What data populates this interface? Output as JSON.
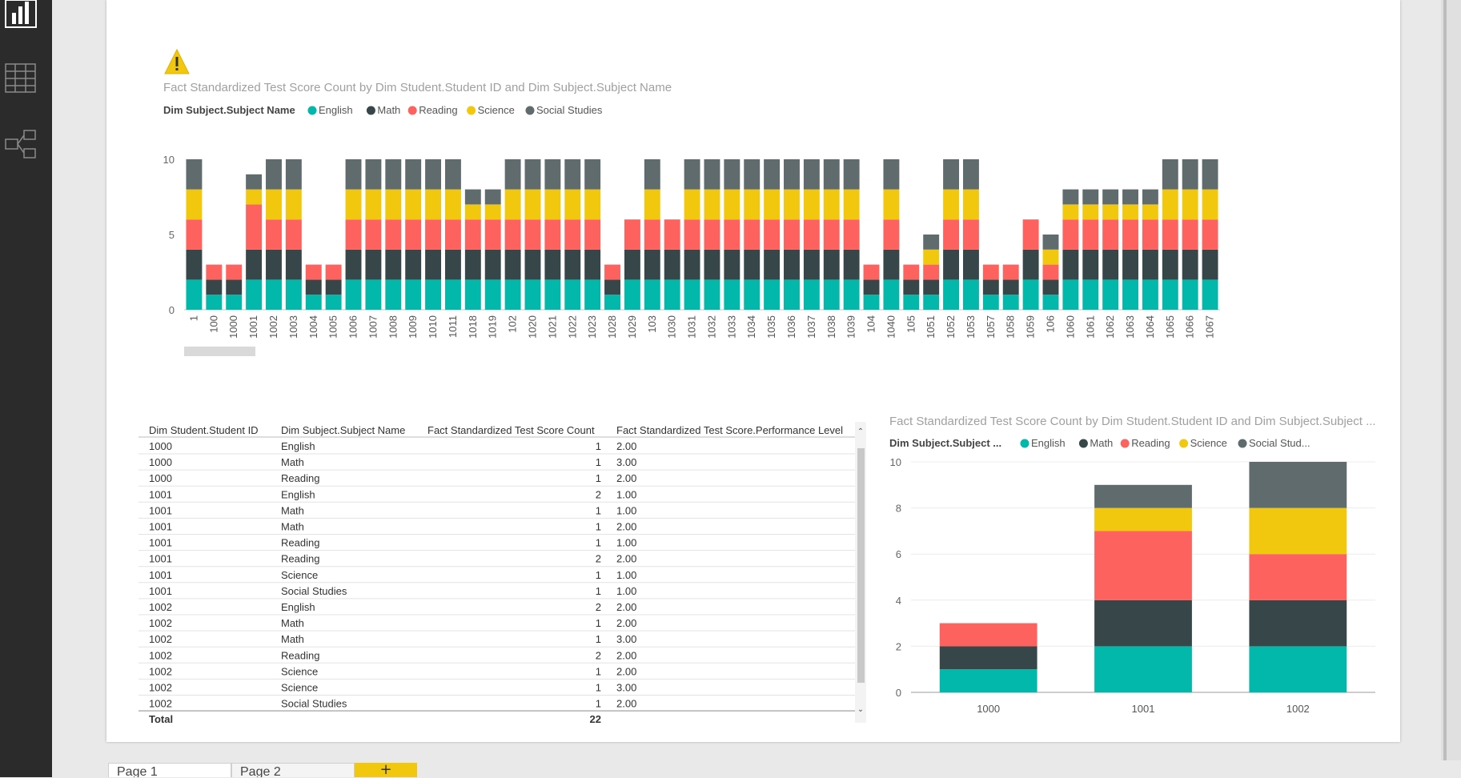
{
  "warning_icon": "warning-triangle-icon",
  "left_nav": [
    {
      "icon": "report-view-icon",
      "active": true
    },
    {
      "icon": "data-view-icon",
      "active": false
    },
    {
      "icon": "relationship-view-icon",
      "active": false
    }
  ],
  "colors": {
    "English": "#01b8aa",
    "Math": "#374649",
    "Reading": "#fd625e",
    "Science": "#f2c80f",
    "Social Studies": "#5f6b6d"
  },
  "chart_data": [
    {
      "type": "bar",
      "stacked": true,
      "title": "Fact Standardized Test Score Count by Dim Student.Student ID and Dim Subject.Subject Name",
      "legend_title": "Dim Subject.Subject Name",
      "legend": [
        "English",
        "Math",
        "Reading",
        "Science",
        "Social Studies"
      ],
      "legend_position": "top-left",
      "ylim": [
        0,
        10
      ],
      "yticks": [
        0,
        5,
        10
      ],
      "grid": false,
      "categories": [
        "1",
        "100",
        "1000",
        "1001",
        "1002",
        "1003",
        "1004",
        "1005",
        "1006",
        "1007",
        "1008",
        "1009",
        "1010",
        "1011",
        "1018",
        "1019",
        "102",
        "1020",
        "1021",
        "1022",
        "1023",
        "1028",
        "1029",
        "103",
        "1030",
        "1031",
        "1032",
        "1033",
        "1034",
        "1035",
        "1036",
        "1037",
        "1038",
        "1039",
        "104",
        "1040",
        "105",
        "1051",
        "1052",
        "1053",
        "1057",
        "1058",
        "1059",
        "106",
        "1060",
        "1061",
        "1062",
        "1063",
        "1064",
        "1065",
        "1066",
        "1067"
      ],
      "series": [
        {
          "name": "English",
          "values": [
            2,
            1,
            1,
            2,
            2,
            2,
            1,
            1,
            2,
            2,
            2,
            2,
            2,
            2,
            2,
            2,
            2,
            2,
            2,
            2,
            2,
            1,
            2,
            2,
            2,
            2,
            2,
            2,
            2,
            2,
            2,
            2,
            2,
            2,
            1,
            2,
            1,
            1,
            2,
            2,
            1,
            1,
            2,
            1,
            2,
            2,
            2,
            2,
            2,
            2,
            2,
            2
          ]
        },
        {
          "name": "Math",
          "values": [
            2,
            1,
            1,
            2,
            2,
            2,
            1,
            1,
            2,
            2,
            2,
            2,
            2,
            2,
            2,
            2,
            2,
            2,
            2,
            2,
            2,
            1,
            2,
            2,
            2,
            2,
            2,
            2,
            2,
            2,
            2,
            2,
            2,
            2,
            1,
            2,
            1,
            1,
            2,
            2,
            1,
            1,
            2,
            1,
            2,
            2,
            2,
            2,
            2,
            2,
            2,
            2
          ]
        },
        {
          "name": "Reading",
          "values": [
            2,
            1,
            1,
            3,
            2,
            2,
            1,
            1,
            2,
            2,
            2,
            2,
            2,
            2,
            2,
            2,
            2,
            2,
            2,
            2,
            2,
            1,
            2,
            2,
            2,
            2,
            2,
            2,
            2,
            2,
            2,
            2,
            2,
            2,
            1,
            2,
            1,
            1,
            2,
            2,
            1,
            1,
            2,
            1,
            2,
            2,
            2,
            2,
            2,
            2,
            2,
            2
          ]
        },
        {
          "name": "Science",
          "values": [
            2,
            0,
            0,
            1,
            2,
            2,
            0,
            0,
            2,
            2,
            2,
            2,
            2,
            2,
            1,
            1,
            2,
            2,
            2,
            2,
            2,
            0,
            0,
            2,
            0,
            2,
            2,
            2,
            2,
            2,
            2,
            2,
            2,
            2,
            0,
            2,
            0,
            1,
            2,
            2,
            0,
            0,
            0,
            1,
            1,
            1,
            1,
            1,
            1,
            2,
            2,
            2
          ]
        },
        {
          "name": "Social Studies",
          "values": [
            2,
            0,
            0,
            1,
            2,
            2,
            0,
            0,
            2,
            2,
            2,
            2,
            2,
            2,
            1,
            1,
            2,
            2,
            2,
            2,
            2,
            0,
            0,
            2,
            0,
            2,
            2,
            2,
            2,
            2,
            2,
            2,
            2,
            2,
            0,
            2,
            0,
            1,
            2,
            2,
            0,
            0,
            0,
            1,
            1,
            1,
            1,
            1,
            1,
            2,
            2,
            2
          ]
        }
      ]
    },
    {
      "type": "bar",
      "stacked": true,
      "title": "Fact Standardized Test Score Count by Dim Student.Student ID and Dim Subject.Subject ...",
      "legend_title": "Dim Subject.Subject ...",
      "legend": [
        "English",
        "Math",
        "Reading",
        "Science",
        "Social Stud..."
      ],
      "legend_position": "top-left",
      "ylim": [
        0,
        10
      ],
      "yticks": [
        0,
        2,
        4,
        6,
        8,
        10
      ],
      "grid": true,
      "categories": [
        "1000",
        "1001",
        "1002"
      ],
      "series": [
        {
          "name": "English",
          "values": [
            1,
            2,
            2
          ]
        },
        {
          "name": "Math",
          "values": [
            1,
            2,
            2
          ]
        },
        {
          "name": "Reading",
          "values": [
            1,
            3,
            2
          ]
        },
        {
          "name": "Science",
          "values": [
            0,
            1,
            2
          ]
        },
        {
          "name": "Social Studies",
          "values": [
            0,
            1,
            2
          ]
        }
      ]
    },
    {
      "type": "table",
      "columns": [
        "Dim Student.Student ID",
        "Dim Subject.Subject Name",
        "Fact Standardized Test Score Count",
        "Fact Standardized Test Score.Performance Level"
      ],
      "rows": [
        [
          "1000",
          "English",
          "1",
          "2.00"
        ],
        [
          "1000",
          "Math",
          "1",
          "3.00"
        ],
        [
          "1000",
          "Reading",
          "1",
          "2.00"
        ],
        [
          "1001",
          "English",
          "2",
          "1.00"
        ],
        [
          "1001",
          "Math",
          "1",
          "1.00"
        ],
        [
          "1001",
          "Math",
          "1",
          "2.00"
        ],
        [
          "1001",
          "Reading",
          "1",
          "1.00"
        ],
        [
          "1001",
          "Reading",
          "2",
          "2.00"
        ],
        [
          "1001",
          "Science",
          "1",
          "1.00"
        ],
        [
          "1001",
          "Social Studies",
          "1",
          "1.00"
        ],
        [
          "1002",
          "English",
          "2",
          "2.00"
        ],
        [
          "1002",
          "Math",
          "1",
          "2.00"
        ],
        [
          "1002",
          "Math",
          "1",
          "3.00"
        ],
        [
          "1002",
          "Reading",
          "2",
          "2.00"
        ],
        [
          "1002",
          "Science",
          "1",
          "2.00"
        ],
        [
          "1002",
          "Science",
          "1",
          "3.00"
        ],
        [
          "1002",
          "Social Studies",
          "1",
          "2.00"
        ]
      ],
      "total_label": "Total",
      "total_value": "22"
    }
  ],
  "tabs": [
    {
      "label": "Page 1",
      "active": true
    },
    {
      "label": "Page 2",
      "active": false
    }
  ],
  "add_page_label": "+"
}
